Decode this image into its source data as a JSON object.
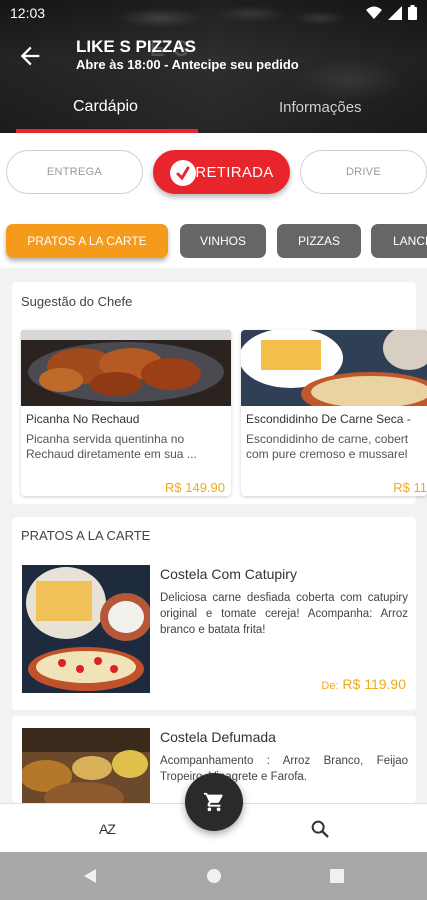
{
  "status_bar": {
    "time": "12:03",
    "icons": [
      "wifi-icon",
      "signal-icon",
      "battery-icon"
    ]
  },
  "header": {
    "title": "LIKE S PIZZAS",
    "subtitle": "Abre às 18:00 - Antecipe seu pedido",
    "tabs": [
      {
        "label": "Cardápio",
        "active": true
      },
      {
        "label": "Informações",
        "active": false
      }
    ]
  },
  "delivery_modes": [
    {
      "label": "ENTREGA",
      "active": false
    },
    {
      "label": "RETIRADA",
      "active": true
    },
    {
      "label": "DRIVE",
      "active": false
    }
  ],
  "categories": [
    {
      "label": "PRATOS A LA CARTE",
      "active": true
    },
    {
      "label": "VINHOS",
      "active": false
    },
    {
      "label": "PIZZAS",
      "active": false
    },
    {
      "label": "LANCH",
      "active": false
    }
  ],
  "chef_suggestions": {
    "title": "Sugestão do Chefe",
    "items": [
      {
        "name": "Picanha No Rechaud",
        "description": "Picanha servida quentinha no Rechaud diretamente em sua ...",
        "price": "R$ 149.90"
      },
      {
        "name": "Escondidinho De Carne Seca - ",
        "description": "Escondidinho de carne, cobert com pure cremoso e mussarel",
        "price": "R$ 11"
      }
    ]
  },
  "section": {
    "title": "PRATOS A LA CARTE",
    "items": [
      {
        "name": "Costela Com Catupiry",
        "description": "Deliciosa carne desfiada coberta com catupiry original e tomate cereja! Acompanha: Arroz branco e batata frita!",
        "price_prefix": "De:",
        "price": "R$ 119.90"
      },
      {
        "name": "Costela Defumada",
        "description": "Acompanhamento : Arroz Branco, Feijao Tropeiro, Vinagrete e Farofa."
      }
    ]
  },
  "bottom_bar": {
    "sort_label": "AZ",
    "icons": [
      "sort-az-icon",
      "cart-icon",
      "search-icon"
    ]
  },
  "colors": {
    "accent": "#e8252a",
    "active_chip": "#f59a1a",
    "price": "#f0a91c",
    "chip": "#666666"
  }
}
